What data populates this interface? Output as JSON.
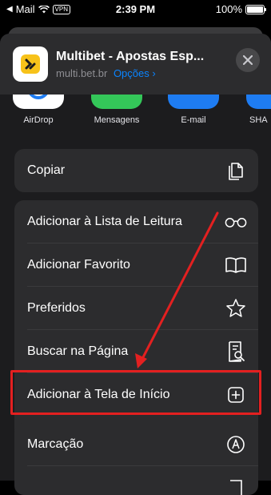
{
  "status": {
    "carrier": "Mail",
    "vpn": "VPN",
    "time": "2:39 PM",
    "battery": "100%",
    "battery_level": 1.0
  },
  "header": {
    "title": "Multibet - Apostas Esp...",
    "url": "multi.bet.br",
    "options": "Opções",
    "options_chevron": "›",
    "close_icon": "close-icon",
    "app_icon": "multibet-logo"
  },
  "share": [
    {
      "label": "AirDrop",
      "icon": "airdrop-icon",
      "color": "#ffffff"
    },
    {
      "label": "Mensagens",
      "icon": "messages-icon",
      "color": "#34c759"
    },
    {
      "label": "E-mail",
      "icon": "mail-icon",
      "color": "#1e7cf2"
    },
    {
      "label": "SHA",
      "icon": "share-icon",
      "color": "#1e7cf2"
    }
  ],
  "actions": {
    "copy": {
      "label": "Copiar",
      "icon": "copy-icon"
    },
    "reading_list": {
      "label": "Adicionar à Lista de Leitura",
      "icon": "glasses-icon"
    },
    "favorite": {
      "label": "Adicionar Favorito",
      "icon": "book-icon"
    },
    "favorites": {
      "label": "Preferidos",
      "icon": "star-icon"
    },
    "find": {
      "label": "Buscar na Página",
      "icon": "find-icon"
    },
    "home_screen": {
      "label": "Adicionar à Tela de Início",
      "icon": "plus-square-icon"
    },
    "markup": {
      "label": "Marcação",
      "icon": "markup-icon"
    }
  },
  "colors": {
    "highlight": "#e32020",
    "accent": "#0a84ff",
    "logo": "#f7c21a"
  }
}
